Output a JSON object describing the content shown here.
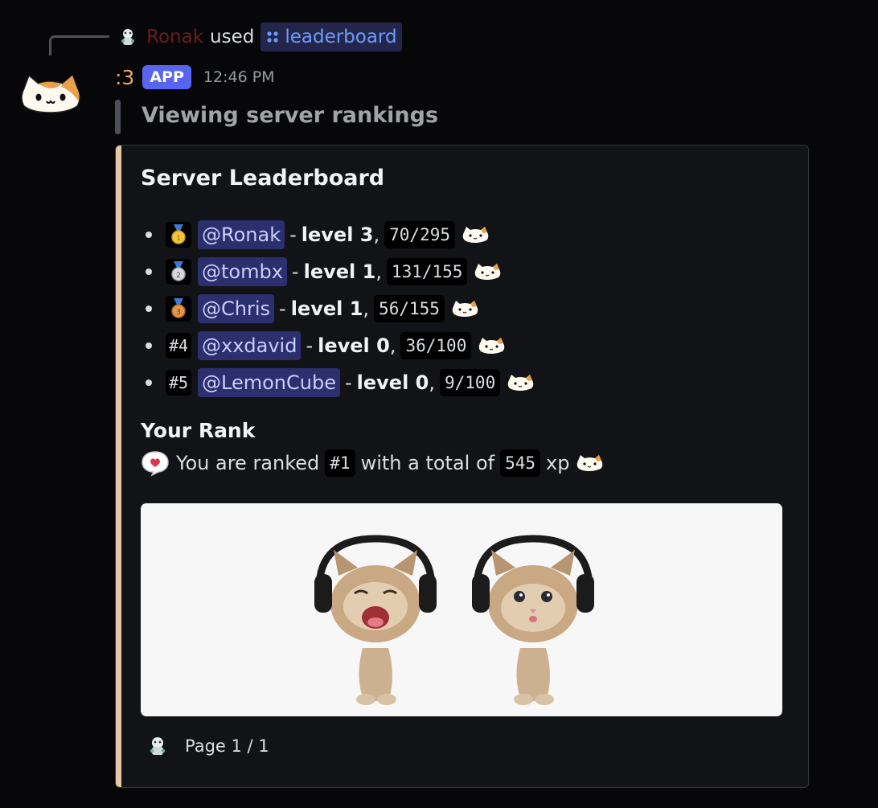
{
  "reply": {
    "username": "Ronak",
    "used_text": "used",
    "command": "leaderboard"
  },
  "message": {
    "author": ":3",
    "app_badge": "APP",
    "timestamp": "12:46 PM",
    "quote": "Viewing server rankings"
  },
  "embed": {
    "accent_color": "#e5c8a6",
    "title": "Server Leaderboard",
    "entries": [
      {
        "rank": "1",
        "rank_icon": "gold-medal-icon",
        "user": "@Ronak",
        "level": "level 3",
        "xp": "70/295"
      },
      {
        "rank": "2",
        "rank_icon": "silver-medal-icon",
        "user": "@tombx",
        "level": "level 1",
        "xp": "131/155"
      },
      {
        "rank": "3",
        "rank_icon": "bronze-medal-icon",
        "user": "@Chris",
        "level": "level 1",
        "xp": "56/155"
      },
      {
        "rank": "#4",
        "user": "@xxdavid",
        "level": "level 0",
        "xp": "36/100"
      },
      {
        "rank": "#5",
        "user": "@LemonCube",
        "level": "level 0",
        "xp": "9/100"
      }
    ],
    "separator": "-",
    "comma": ",",
    "your_rank": {
      "heading": "Your Rank",
      "text_before": "You are ranked",
      "rank": "#1",
      "text_middle": "with a total of",
      "xp": "545",
      "text_after": "xp"
    },
    "image_alt": "two-kittens-with-headphones",
    "footer": "Page 1 / 1"
  }
}
